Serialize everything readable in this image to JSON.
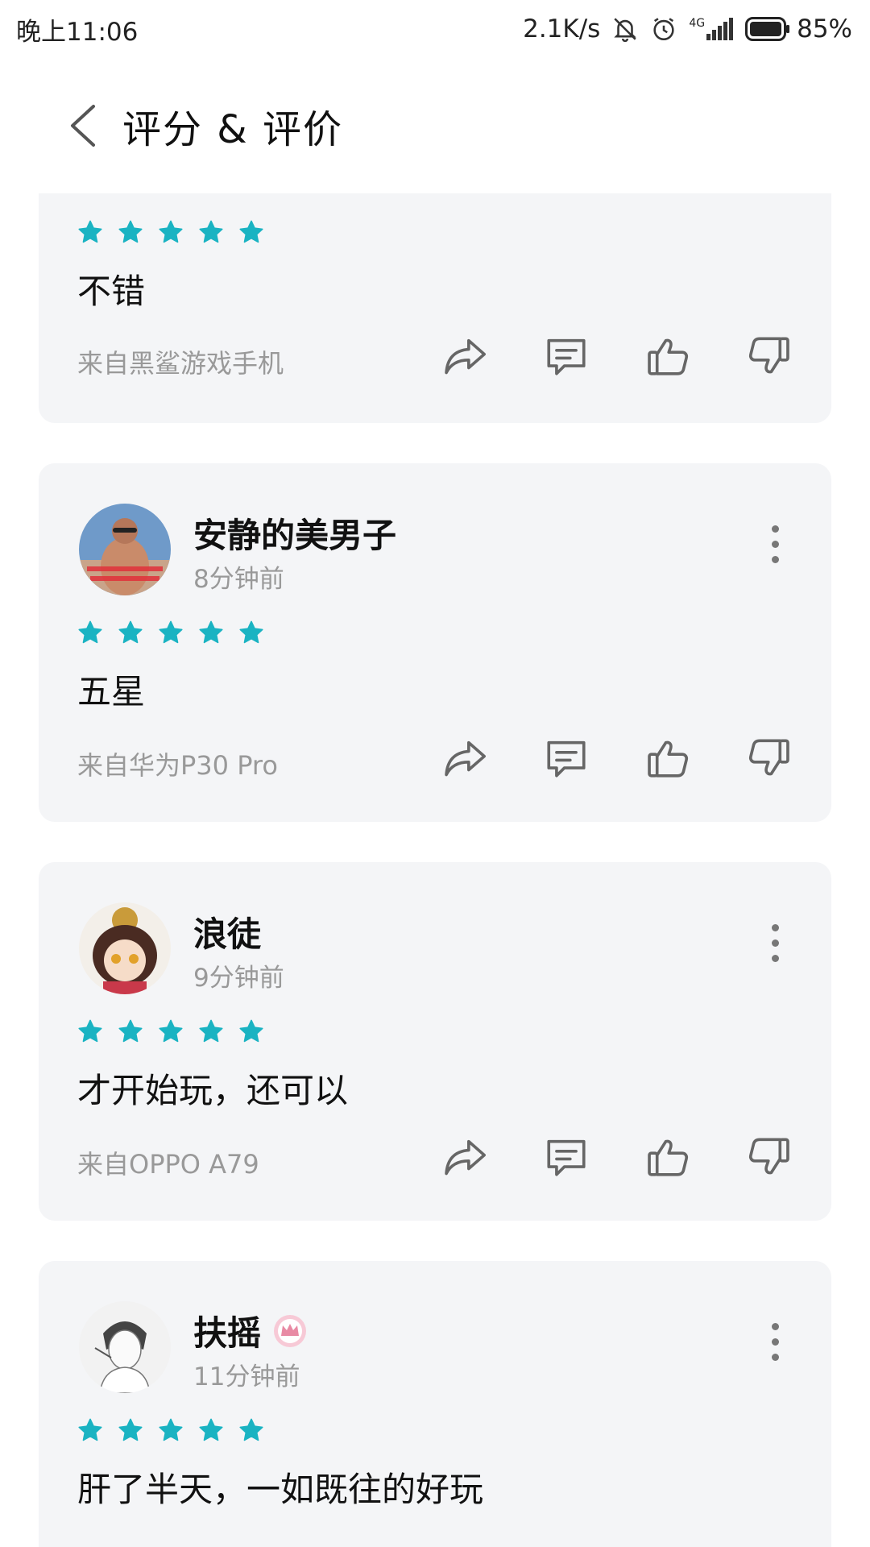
{
  "status_bar": {
    "time": "晚上11:06",
    "network_speed": "2.1K/s",
    "signal_label": "4G",
    "battery_percent": "85%"
  },
  "header": {
    "title": "评分 & 评价"
  },
  "colors": {
    "star": "#1ab3c2",
    "icon": "#666666",
    "card_bg": "#f4f5f7",
    "muted_text": "#999999",
    "crown_badge": "#e88aa4"
  },
  "reviews": [
    {
      "user": "",
      "time": "",
      "rating": 5,
      "text": "不错",
      "device": "来自黑鲨游戏手机"
    },
    {
      "user": "安静的美男子",
      "time": "8分钟前",
      "rating": 5,
      "text": "五星",
      "device": "来自华为P30 Pro"
    },
    {
      "user": "浪徒",
      "time": "9分钟前",
      "rating": 5,
      "text": "才开始玩，还可以",
      "device": "来自OPPO A79"
    },
    {
      "user": "扶摇",
      "time": "11分钟前",
      "rating": 5,
      "text": "肝了半天，一如既往的好玩",
      "device": ""
    }
  ],
  "icons": {
    "back": "chevron-left-icon",
    "share": "share-icon",
    "comment": "comment-icon",
    "like": "thumbs-up-icon",
    "dislike": "thumbs-down-icon",
    "more": "more-vertical-icon",
    "badge": "crown-badge-icon"
  }
}
